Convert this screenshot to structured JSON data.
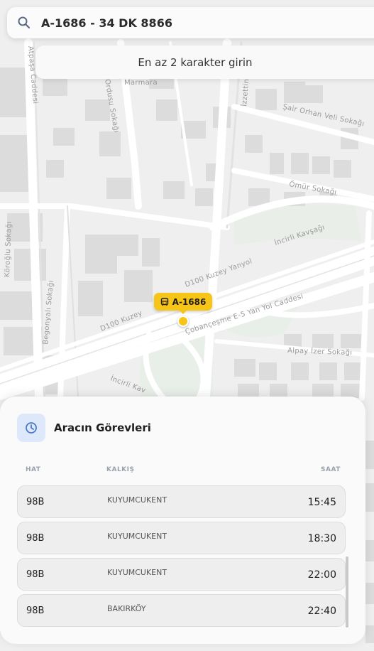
{
  "search": {
    "value": "A-1686 - 34 DK 8866",
    "hint": "En az 2 karakter girin"
  },
  "map": {
    "street_labels": [
      "Atpaşa Caddesi",
      "Marmara",
      "Ordusu Sokağı",
      "İzzettin",
      "Şair Orhan Veli Sokağı",
      "Ömür Sokağı",
      "İncirli Kavşağı",
      "Köroğlu Sokağı",
      "D100 Kuzey Yanyol",
      "D100 Kuzey",
      "Begonyalı Sokağı",
      "Çobançeşme E-5 Yan Yol Caddesi",
      "Alpay İzer Sokağı",
      "İncirli Kav"
    ],
    "vehicle_marker": "A-1686"
  },
  "panel": {
    "title": "Aracın Görevleri",
    "columns": {
      "hat": "HAT",
      "kalkis": "KALKIŞ",
      "saat": "SAAT"
    },
    "rows": [
      {
        "hat": "98B",
        "kalkis": "KUYUMCUKENT",
        "saat": "15:45"
      },
      {
        "hat": "98B",
        "kalkis": "KUYUMCUKENT",
        "saat": "18:30"
      },
      {
        "hat": "98B",
        "kalkis": "KUYUMCUKENT",
        "saat": "22:00"
      },
      {
        "hat": "98B",
        "kalkis": "BAKIRKÖY",
        "saat": "22:40"
      }
    ]
  },
  "colors": {
    "accent": "#f7c418",
    "clock_bg": "#dde9fb",
    "clock_icon": "#4a78c8"
  }
}
